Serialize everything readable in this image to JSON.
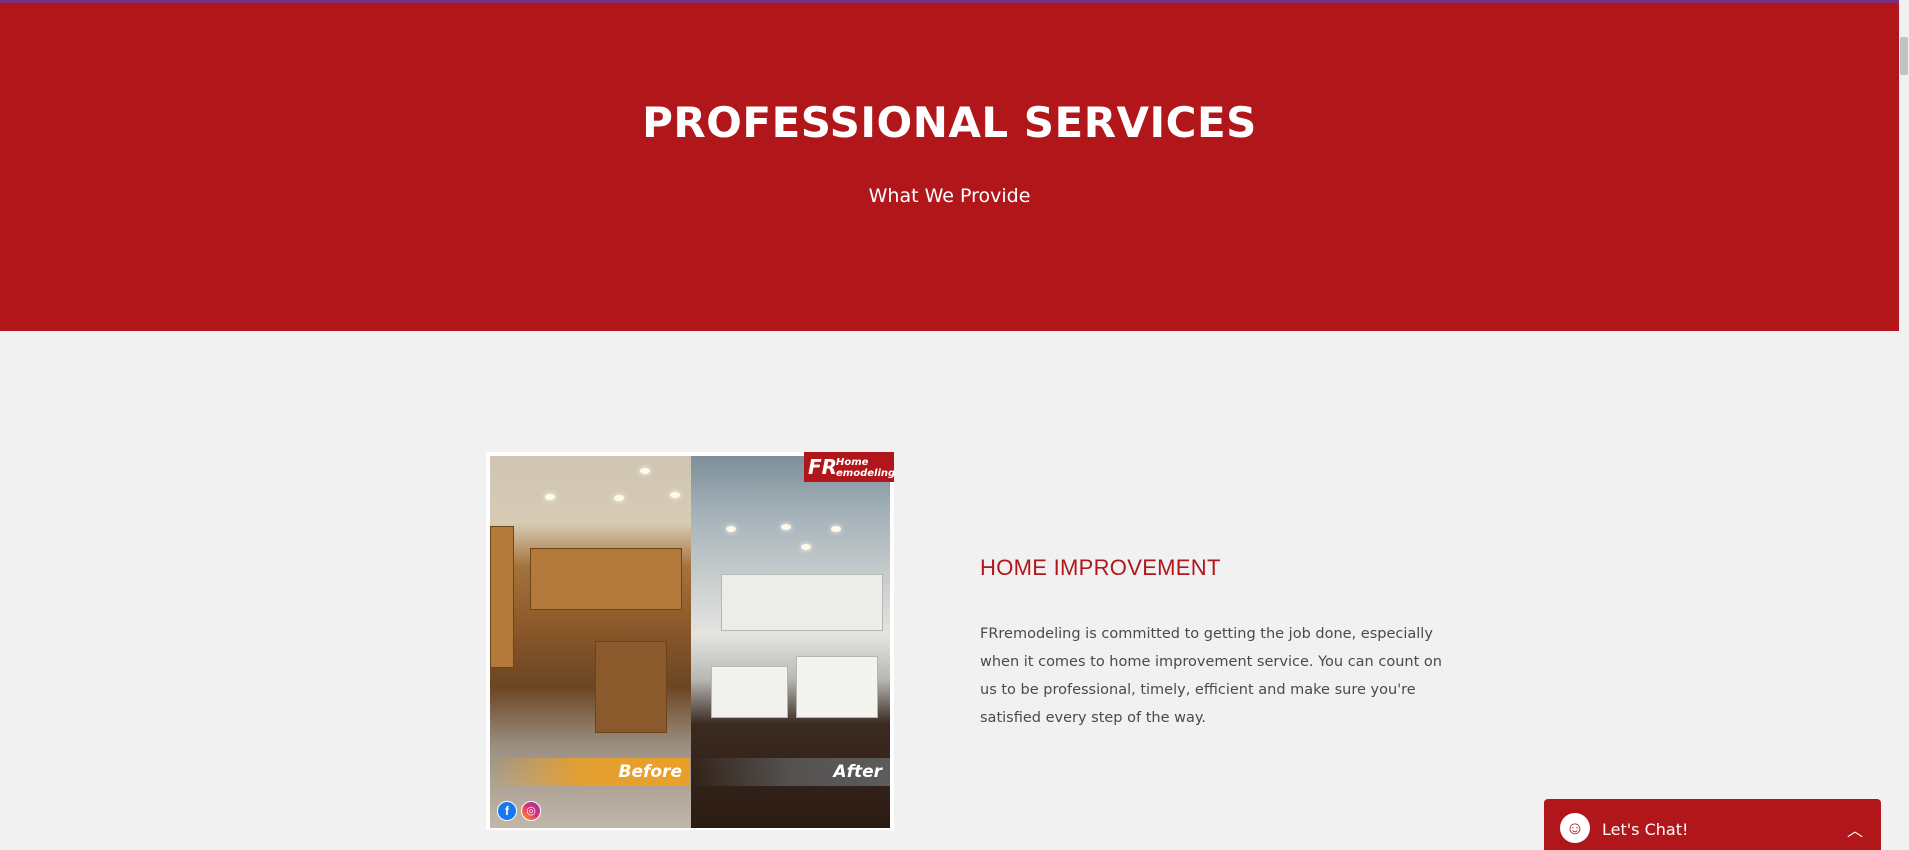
{
  "colors": {
    "brand_red": "#b1161b",
    "page_bg": "#f1f1f1",
    "text_gray": "#4a4a4a"
  },
  "hero": {
    "title": "PROFESSIONAL SERVICES",
    "subtitle": "What We Provide"
  },
  "service": {
    "title": "HOME IMPROVEMENT",
    "description": "FRremodeling is committed to getting the job done, especially when it comes to home improvement service. You can count on us to be professional, timely, efficient and make sure you're satisfied every step of the way.",
    "image": {
      "logo_mark": "FR",
      "logo_line1": "Home",
      "logo_line2": "emodeling",
      "before_label": "Before",
      "after_label": "After",
      "social_icons": [
        "facebook-icon",
        "instagram-icon"
      ]
    }
  },
  "chat": {
    "label": "Let's Chat!",
    "avatar_icon": "smiley-icon",
    "toggle_icon": "chevron-up-icon"
  }
}
